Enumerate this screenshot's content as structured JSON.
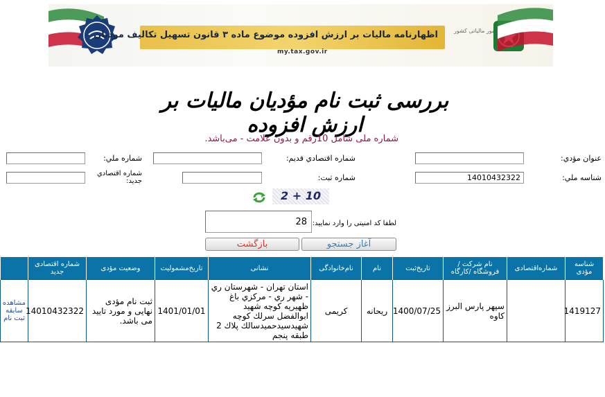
{
  "banner": {
    "title": "اظهارنامه مالیات بر ارزش افزوده موضوع ماده ۳ قانون تسهیل تکالیف مودیان",
    "url": "my.tax.gov.ir",
    "org": "سازمان امور مالیاتی کشور",
    "colors": {
      "strip": "#e9c04a",
      "flag_green": "#2e8b3e",
      "flag_red": "#c8102e",
      "seal": "#1a3d7a"
    }
  },
  "page": {
    "title": "بررسی ثبت نام مؤدیان مالیات بر ارزش افزوده",
    "note": "شماره ملی شامل 10رقم و بدون علامت - می‌باشد."
  },
  "form": {
    "title_label": "عنوان مؤدي:",
    "title_value": "",
    "old_econ_label": "شماره اقتصادي قديم:",
    "old_econ_value": "",
    "national_no_label": "شماره ملي:",
    "national_no_value": "",
    "national_id_label": "شناسه ملي:",
    "national_id_value": "14010432322",
    "reg_no_label": "شماره ثبت:",
    "reg_no_value": "",
    "new_econ_label": "شماره اقتصادي جديد:",
    "new_econ_value": "",
    "captcha_text": "2 + 10",
    "captcha_label": "لطفا کد امنيتی را وارد نماييد:",
    "captcha_value": "28",
    "search_button": "آغاز جستجو",
    "back_button": "بازگشت"
  },
  "table": {
    "headers": [
      "شناسه مؤدی",
      "شماره‌اقتصادی",
      "نام شرکت / فروشگاه /کارگاه",
      "تاریخ‌ثبت",
      "نام",
      "نام‌خانوادگی",
      "نشانی",
      "تاریخ‌مشمولیت",
      "وضعیت مؤدی",
      "شماره اقتصادی جدید",
      ""
    ],
    "rows": [
      {
        "taxpayer_id": "1419127",
        "econ_no": "",
        "company": "سپهر پارس البرز کاوه",
        "reg_date": "1400/07/25",
        "first_name": "ریحانه",
        "last_name": "کریمی",
        "address": "استان تهران - شهرستان ري - شهر ري - مركزي باغ ظهيريه كوچه شهيد ابوالفضل سرلك كوچه شهيدسيدحميدسالك پلاك 2 طبقه پنجم",
        "inclusion_date": "1401/01/01",
        "status": "ثبت نام مؤدی نهایی و مورد تایید می باشد.",
        "new_econ_no": "14010432322",
        "history_link": "مشاهده سابقه ثبت نام"
      }
    ]
  }
}
